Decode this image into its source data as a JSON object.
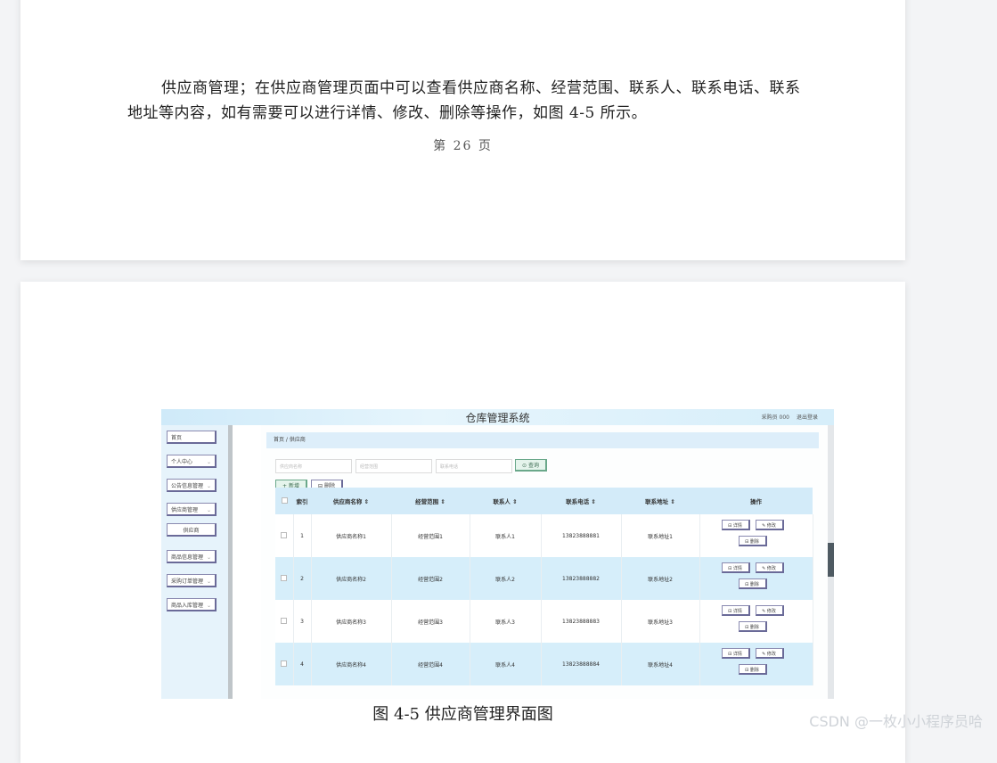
{
  "paragraph": "供应商管理；在供应商管理页面中可以查看供应商名称、经营范围、联系人、联系电话、联系地址等内容，如有需要可以进行详情、修改、删除等操作，如图 4-5 所示。",
  "page_number": "第 26 页",
  "caption": "图 4-5 供应商管理界面图",
  "watermark": "CSDN @一枚小小程序员哈",
  "screenshot": {
    "system_title": "仓库管理系统",
    "user": "采购员 000",
    "logout": "退出登录",
    "sidebar": [
      {
        "label": "首页",
        "chevron": ""
      },
      {
        "label": "个人中心",
        "chevron": "⌄"
      },
      {
        "label": "公告信息管理",
        "chevron": "⌄"
      },
      {
        "label": "供应商管理",
        "chevron": "⌄"
      },
      {
        "label": "供应商",
        "chevron": ""
      },
      {
        "label": "商品信息管理",
        "chevron": "⌄"
      },
      {
        "label": "采购订单管理",
        "chevron": "⌄"
      },
      {
        "label": "商品入库管理",
        "chevron": "⌄"
      }
    ],
    "breadcrumb": "首页 / 供应商",
    "search": {
      "name_placeholder": "供应商名称",
      "scope_placeholder": "经营范围",
      "phone_placeholder": "联系电话",
      "query_label": "⊙ 查询"
    },
    "toolbar": {
      "add_label": "+ 新增",
      "delete_label": "⊟ 删除"
    },
    "table": {
      "headers": [
        "",
        "索引",
        "供应商名称 ⇕",
        "经营范围 ⇕",
        "联系人 ⇕",
        "联系电话 ⇕",
        "联系地址 ⇕",
        "操作"
      ],
      "rows": [
        {
          "index": "1",
          "name": "供应商名称1",
          "scope": "经营范围1",
          "contact": "联系人1",
          "phone": "13823888881",
          "address": "联系地址1"
        },
        {
          "index": "2",
          "name": "供应商名称2",
          "scope": "经营范围2",
          "contact": "联系人2",
          "phone": "13823888882",
          "address": "联系地址2"
        },
        {
          "index": "3",
          "name": "供应商名称3",
          "scope": "经营范围3",
          "contact": "联系人3",
          "phone": "13823888883",
          "address": "联系地址3"
        },
        {
          "index": "4",
          "name": "供应商名称4",
          "scope": "经营范围4",
          "contact": "联系人4",
          "phone": "13823888884",
          "address": "联系地址4"
        }
      ],
      "actions": {
        "detail": "⊟ 详情",
        "edit": "✎ 修改",
        "delete": "⊟ 删除"
      }
    }
  }
}
